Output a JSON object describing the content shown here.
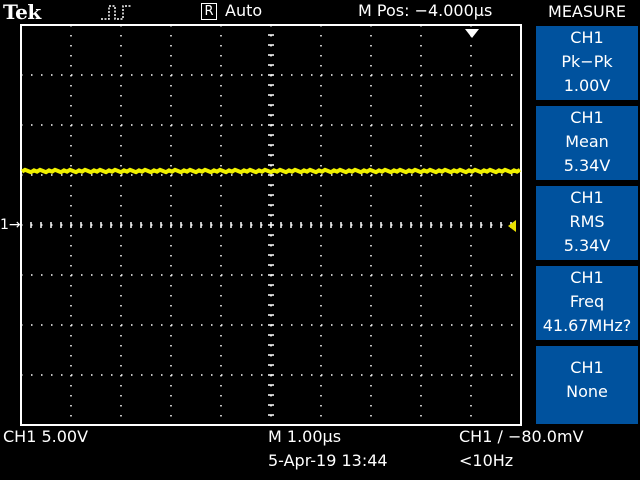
{
  "header": {
    "brand": "Tek",
    "trigger_icon": "trigger-pulse-icon",
    "acq_box_letter": "R",
    "acq_mode": "Auto",
    "mpos": "M Pos: −4.000µs"
  },
  "measure": {
    "title": "MEASURE",
    "items": [
      {
        "channel": "CH1",
        "type": "Pk−Pk",
        "value": "1.00V"
      },
      {
        "channel": "CH1",
        "type": "Mean",
        "value": "5.34V"
      },
      {
        "channel": "CH1",
        "type": "RMS",
        "value": "5.34V"
      },
      {
        "channel": "CH1",
        "type": "Freq",
        "value": "41.67MHz?"
      },
      {
        "channel": "CH1",
        "type": "None",
        "value": ""
      }
    ]
  },
  "markers": {
    "channel_marker": "1"
  },
  "footer": {
    "ch_scale": "CH1  5.00V",
    "timebase": "M 1.00µs",
    "date": "5-Apr-19 13:44",
    "trigger": "CH1 ∕ −80.0mV",
    "trigger_freq": "<10Hz"
  },
  "colors": {
    "trace": "#f0f000",
    "menu_bg": "#00529e",
    "background": "#000000"
  }
}
